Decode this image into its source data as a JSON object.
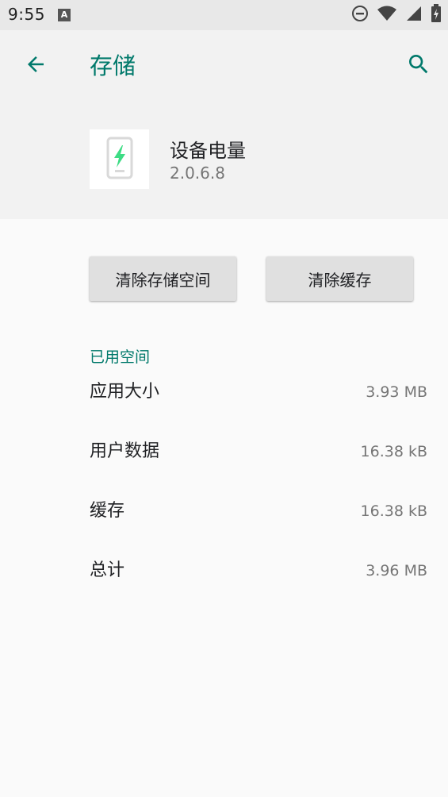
{
  "status_bar": {
    "time": "9:55",
    "notification_icon": "A"
  },
  "header": {
    "title": "存储"
  },
  "app": {
    "name": "设备电量",
    "version": "2.0.6.8"
  },
  "buttons": {
    "clear_storage": "清除存储空间",
    "clear_cache": "清除缓存"
  },
  "section": {
    "title": "已用空间"
  },
  "storage_rows": [
    {
      "label": "应用大小",
      "value": "3.93 MB"
    },
    {
      "label": "用户数据",
      "value": "16.38 kB"
    },
    {
      "label": "缓存",
      "value": "16.38 kB"
    },
    {
      "label": "总计",
      "value": "3.96 MB"
    }
  ],
  "colors": {
    "accent": "#00796b",
    "battery_bolt": "#3ddc84"
  },
  "icons": [
    "arrow-back-icon",
    "search-icon",
    "do-not-disturb-icon",
    "wifi-icon",
    "signal-icon",
    "battery-icon",
    "battery-app-icon"
  ]
}
